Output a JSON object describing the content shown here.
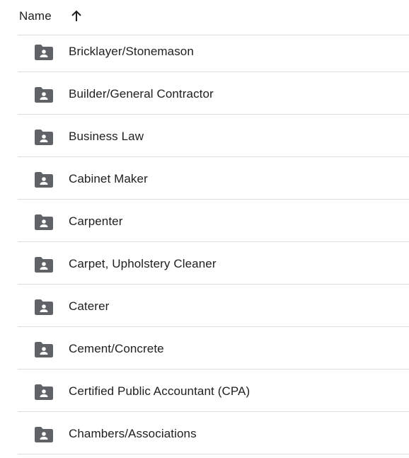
{
  "header": {
    "name_label": "Name",
    "sort_icon": "arrow-up-icon"
  },
  "folders": [
    {
      "label": "Bricklayer/Stonemason",
      "icon": "shared-folder-icon"
    },
    {
      "label": "Builder/General Contractor",
      "icon": "shared-folder-icon"
    },
    {
      "label": "Business Law",
      "icon": "shared-folder-icon"
    },
    {
      "label": "Cabinet Maker",
      "icon": "shared-folder-icon"
    },
    {
      "label": "Carpenter",
      "icon": "shared-folder-icon"
    },
    {
      "label": "Carpet, Upholstery Cleaner",
      "icon": "shared-folder-icon"
    },
    {
      "label": "Caterer",
      "icon": "shared-folder-icon"
    },
    {
      "label": "Cement/Concrete",
      "icon": "shared-folder-icon"
    },
    {
      "label": "Certified Public Accountant (CPA)",
      "icon": "shared-folder-icon"
    },
    {
      "label": "Chambers/Associations",
      "icon": "shared-folder-icon"
    }
  ],
  "colors": {
    "icon": "#5f6368",
    "divider": "#dadce0",
    "text": "#1f1f1f"
  }
}
